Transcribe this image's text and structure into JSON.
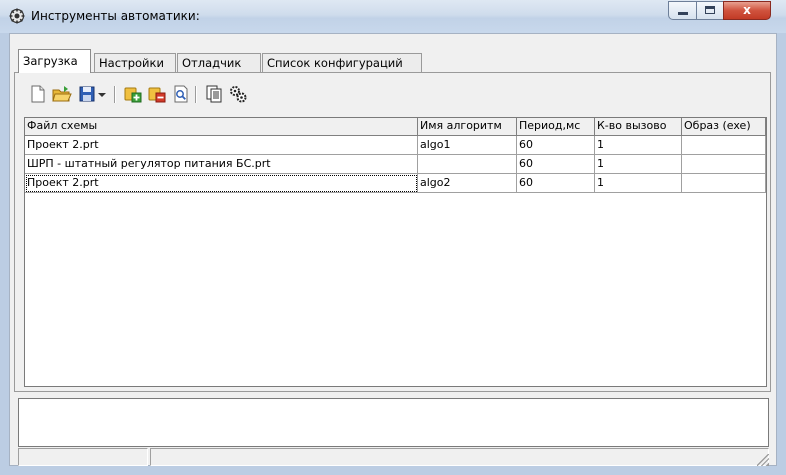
{
  "window": {
    "title": "Инструменты автоматики:",
    "close_glyph": "x"
  },
  "tabs": [
    {
      "label": "Загрузка",
      "active": true
    },
    {
      "label": "Настройки",
      "active": false
    },
    {
      "label": "Отладчик",
      "active": false
    },
    {
      "label": "Список конфигураций",
      "active": false
    }
  ],
  "toolbar": {
    "icons": [
      "new-file-icon",
      "open-folder-icon",
      "save-icon",
      "save-dropdown-arrow-icon",
      "add-algorithm-icon",
      "remove-algorithm-icon",
      "preview-icon",
      "copy-pages-icon",
      "settings-gears-icon"
    ]
  },
  "grid": {
    "columns": [
      "Файл схемы",
      "Имя алгоритм",
      "Период,мс",
      "К-во вызово",
      "Образ (exe)"
    ],
    "rows": [
      [
        "Проект 2.prt",
        "algo1",
        "60",
        "1",
        ""
      ],
      [
        "ШРП - штатный регулятор питания БС.prt",
        "",
        "60",
        "1",
        ""
      ],
      [
        "Проект 2.prt",
        "algo2",
        "60",
        "1",
        ""
      ]
    ]
  },
  "colors": {
    "titlebar": "#c8d8ec",
    "close_button": "#c23b26",
    "window_frame": "#bccde3"
  }
}
